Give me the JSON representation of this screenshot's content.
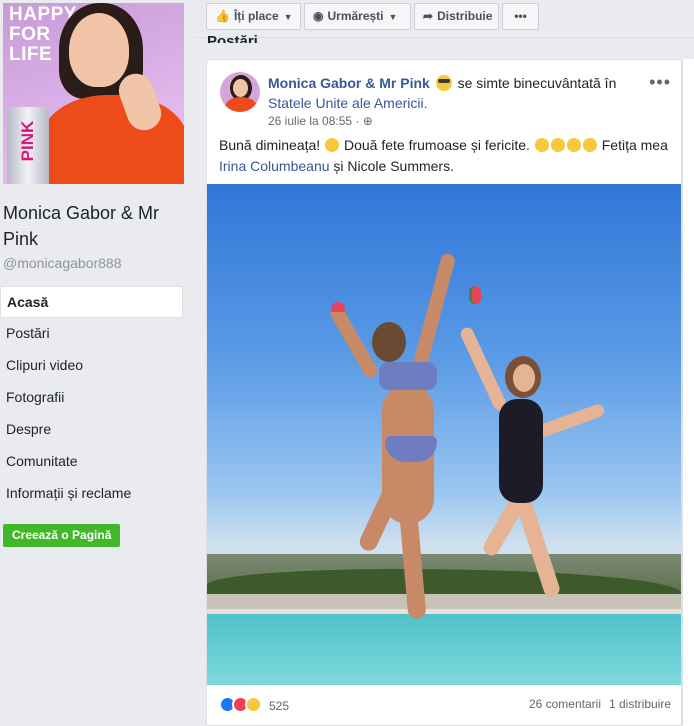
{
  "page": {
    "name": "Monica Gabor & Mr Pink",
    "handle": "@monicagabor888",
    "cover_text": [
      "HAPPY",
      "FOR",
      "LIFE"
    ],
    "cover_can_label": "PINK"
  },
  "nav": {
    "items": [
      {
        "label": "Acasă",
        "active": true
      },
      {
        "label": "Postări"
      },
      {
        "label": "Clipuri video"
      },
      {
        "label": "Fotografii"
      },
      {
        "label": "Despre"
      },
      {
        "label": "Comunitate"
      },
      {
        "label": "Informații și reclame"
      }
    ],
    "create_page": "Creează o Pagină"
  },
  "toolbar": {
    "like": "Îți place",
    "follow": "Urmărești",
    "share": "Distribuie",
    "more": "•••"
  },
  "posts_heading": "Postări",
  "post": {
    "author": "Monica Gabor & Mr Pink",
    "feeling": "se simte binecuvântată în",
    "location": "Statele Unite ale Americii.",
    "timestamp": "26 iulie la 08:55 ·",
    "more": "•••",
    "text_1": "Bună dimineața!",
    "text_2": "Două fete frumoase și fericite.",
    "text_3": "Fetița mea",
    "tag_1": "Irina Columbeanu",
    "text_4": "și Nicole Summers.",
    "reactions_count": "525",
    "comments": "26 comentarii",
    "shares": "1 distribuire"
  },
  "colors": {
    "link": "#365899",
    "create_button": "#42b72a",
    "background": "#e9ebee"
  }
}
